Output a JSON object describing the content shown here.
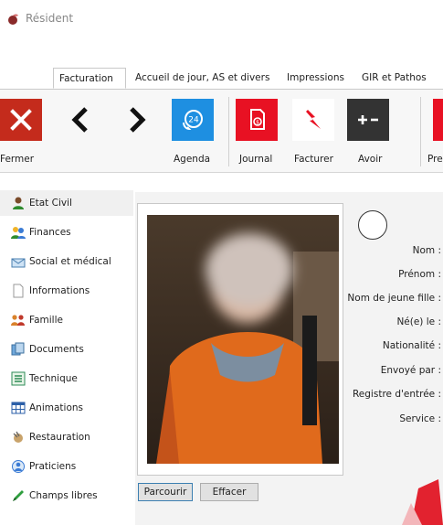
{
  "window": {
    "title": "Résident"
  },
  "tabs": [
    {
      "label": "Facturation",
      "active": true
    },
    {
      "label": "Accueil de jour, AS et divers",
      "active": false
    },
    {
      "label": "Impressions",
      "active": false
    },
    {
      "label": "GIR et Pathos",
      "active": false
    }
  ],
  "ribbon": {
    "buttons": [
      {
        "label": "Fermer",
        "icon": "close-icon",
        "color": "#c42b1c"
      },
      {
        "label": "",
        "icon": "chevron-left-icon"
      },
      {
        "label": "",
        "icon": "chevron-right-icon"
      },
      {
        "label": "Agenda",
        "icon": "agenda-24h-icon",
        "color": "#1e8fe1"
      },
      {
        "label": "Journal",
        "icon": "journal-icon",
        "color": "#e81123"
      },
      {
        "label": "Facturer",
        "icon": "lightning-icon",
        "color": "#e81123"
      },
      {
        "label": "Avoir",
        "icon": "plus-minus-icon",
        "color": "#333333"
      },
      {
        "label": "Pre",
        "icon": "truncated-icon",
        "color": "#e81123"
      }
    ]
  },
  "sidebar": {
    "items": [
      {
        "label": "Etat Civil",
        "icon": "person-icon",
        "active": true
      },
      {
        "label": "Finances",
        "icon": "people-money-icon"
      },
      {
        "label": "Social et médical",
        "icon": "envelope-icon"
      },
      {
        "label": "Informations",
        "icon": "document-icon"
      },
      {
        "label": "Famille",
        "icon": "family-icon"
      },
      {
        "label": "Documents",
        "icon": "documents-icon"
      },
      {
        "label": "Technique",
        "icon": "list-icon"
      },
      {
        "label": "Animations",
        "icon": "calendar-grid-icon"
      },
      {
        "label": "Restauration",
        "icon": "food-icon"
      },
      {
        "label": "Praticiens",
        "icon": "practitioners-icon"
      },
      {
        "label": "Champs libres",
        "icon": "pen-icon"
      }
    ]
  },
  "photo": {
    "browse_label": "Parcourir",
    "clear_label": "Effacer"
  },
  "form": {
    "labels": [
      "Nom :",
      "Prénom :",
      "Nom de jeune fille :",
      "Né(e) le :",
      "Nationalité :",
      "Envoyé par :",
      "Registre d'entrée :",
      "Service :"
    ]
  }
}
